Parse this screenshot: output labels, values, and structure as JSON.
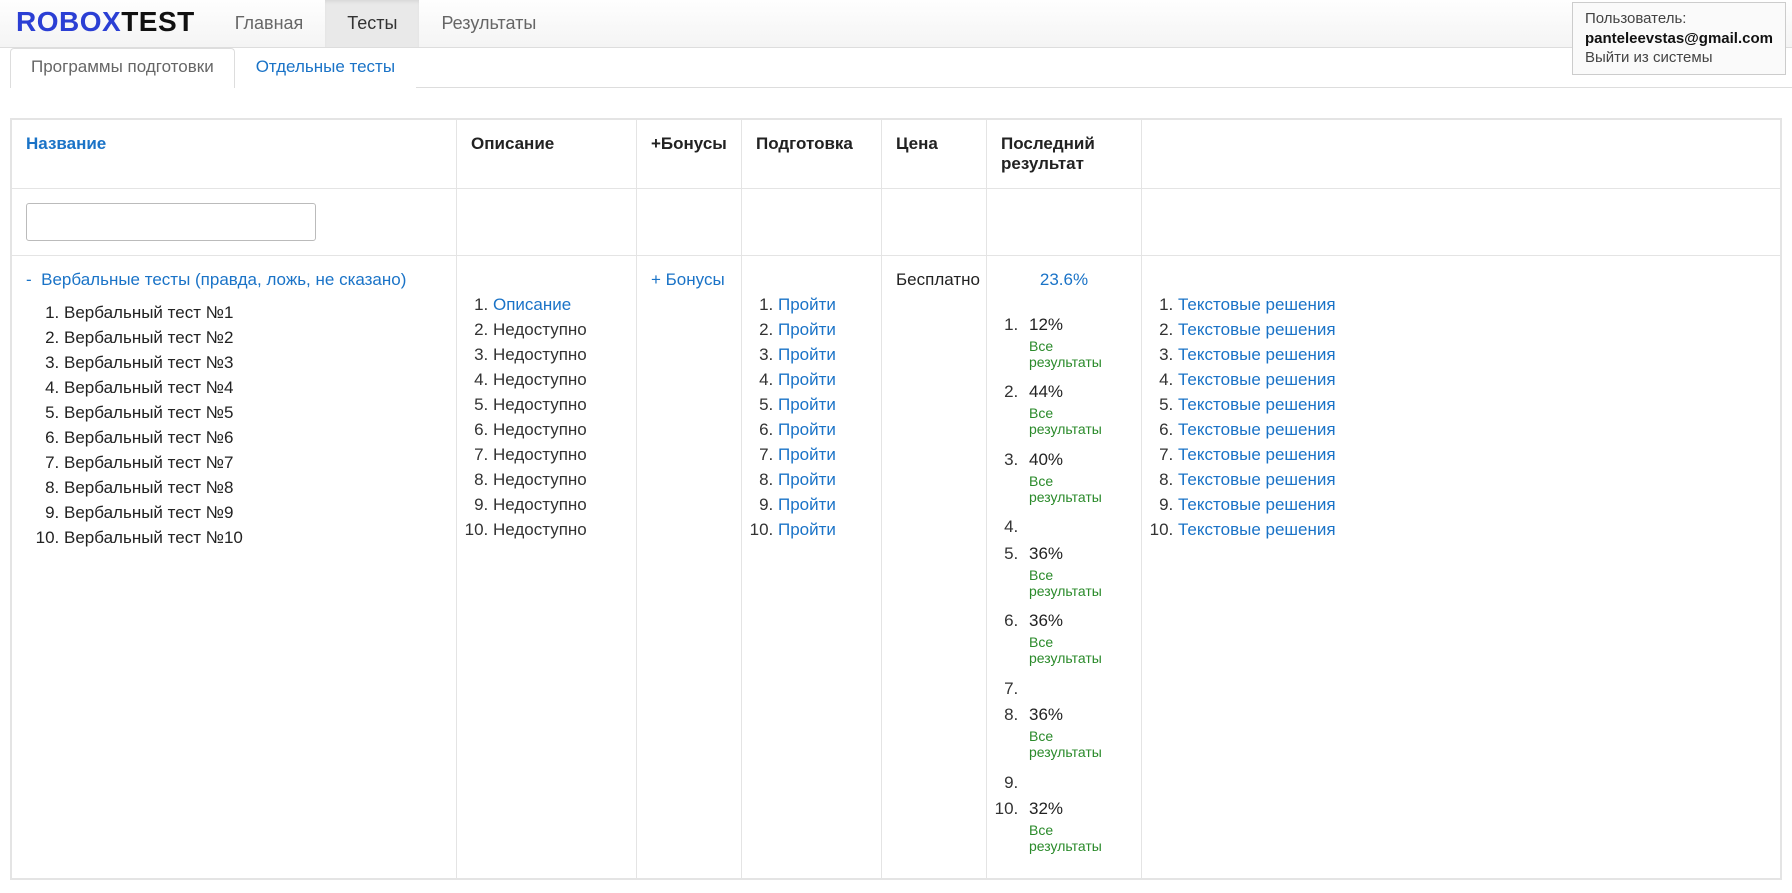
{
  "brand": {
    "part1": "ROBOX",
    "part2": "TEST"
  },
  "nav": {
    "home": "Главная",
    "tests": "Тесты",
    "results": "Результаты"
  },
  "user": {
    "label": "Пользователь:",
    "email": "panteleevstas@gmail.com",
    "logout": "Выйти из системы"
  },
  "subtabs": {
    "programs": "Программы подготовки",
    "single": "Отдельные тесты"
  },
  "columns": {
    "name": "Название",
    "description": "Описание",
    "bonuses": "+Бонусы",
    "preparation": "Подготовка",
    "price": "Цена",
    "lastResult": "Последний результат",
    "solutions": ""
  },
  "row": {
    "toggle": "-",
    "title": "Вербальные тесты (правда, ложь, не сказано)",
    "tests": [
      "Вербальный тест №1",
      "Вербальный тест №2",
      "Вербальный тест №3",
      "Вербальный тест №4",
      "Вербальный тест №5",
      "Вербальный тест №6",
      "Вербальный тест №7",
      "Вербальный тест №8",
      "Вербальный тест №9",
      "Вербальный тест №10"
    ],
    "descriptions": [
      {
        "text": "Описание",
        "link": true
      },
      {
        "text": "Недоступно",
        "link": false
      },
      {
        "text": "Недоступно",
        "link": false
      },
      {
        "text": "Недоступно",
        "link": false
      },
      {
        "text": "Недоступно",
        "link": false
      },
      {
        "text": "Недоступно",
        "link": false
      },
      {
        "text": "Недоступно",
        "link": false
      },
      {
        "text": "Недоступно",
        "link": false
      },
      {
        "text": "Недоступно",
        "link": false
      },
      {
        "text": "Недоступно",
        "link": false
      }
    ],
    "bonusesLink": "+ Бонусы",
    "preparation": [
      "Пройти",
      "Пройти",
      "Пройти",
      "Пройти",
      "Пройти",
      "Пройти",
      "Пройти",
      "Пройти",
      "Пройти",
      "Пройти"
    ],
    "price": "Бесплатно",
    "score": "23.6%",
    "allResultsLabel": "Все результаты",
    "results": [
      {
        "pct": "12%",
        "all": true
      },
      {
        "pct": "44%",
        "all": true
      },
      {
        "pct": "40%",
        "all": true
      },
      {
        "pct": "",
        "all": false
      },
      {
        "pct": "36%",
        "all": true
      },
      {
        "pct": "36%",
        "all": true
      },
      {
        "pct": "",
        "all": false
      },
      {
        "pct": "36%",
        "all": true
      },
      {
        "pct": "",
        "all": false
      },
      {
        "pct": "32%",
        "all": true
      }
    ],
    "solutions": [
      "Текстовые решения",
      "Текстовые решения",
      "Текстовые решения",
      "Текстовые решения",
      "Текстовые решения",
      "Текстовые решения",
      "Текстовые решения",
      "Текстовые решения",
      "Текстовые решения",
      "Текстовые решения"
    ]
  }
}
